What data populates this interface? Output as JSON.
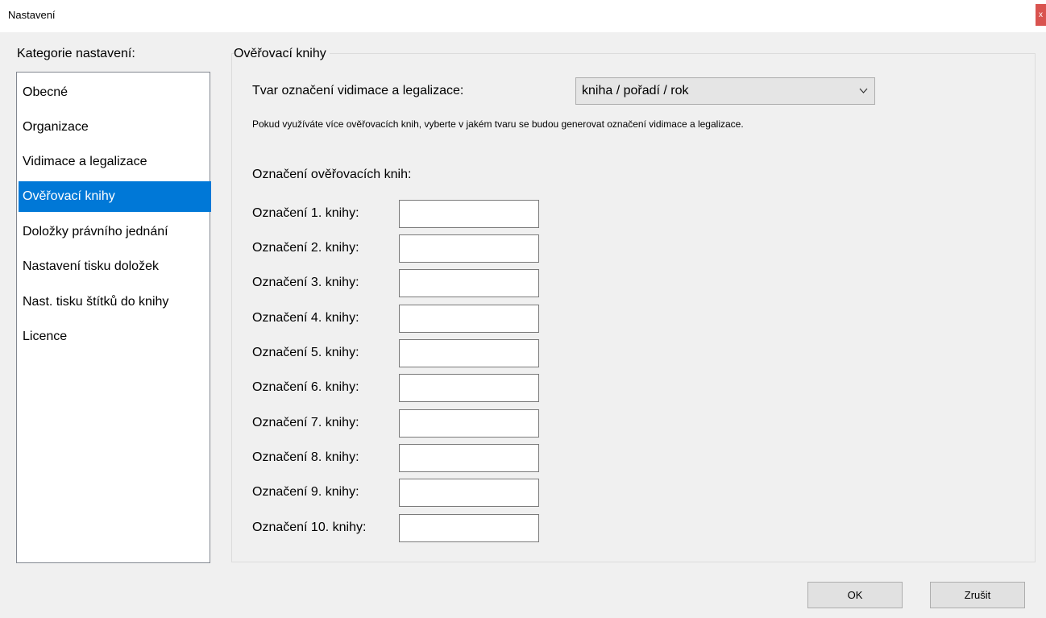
{
  "window": {
    "title": "Nastavení",
    "close_label": "x"
  },
  "categories": {
    "label": "Kategorie nastavení:",
    "items": [
      {
        "label": "Obecné",
        "selected": false
      },
      {
        "label": "Organizace",
        "selected": false
      },
      {
        "label": "Vidimace a legalizace",
        "selected": false
      },
      {
        "label": "Ověřovací knihy",
        "selected": true
      },
      {
        "label": "Doložky právního jednání",
        "selected": false
      },
      {
        "label": "Nastavení tisku doložek",
        "selected": false
      },
      {
        "label": "Nast. tisku štítků do knihy",
        "selected": false
      },
      {
        "label": "Licence",
        "selected": false
      }
    ]
  },
  "panel": {
    "legend": "Ověřovací knihy",
    "format_label": "Tvar označení vidimace a legalizace:",
    "format_value": "kniha / pořadí / rok",
    "hint": "Pokud využíváte více ověřovacích knih, vyberte v jakém tvaru se budou generovat označení vidimace a legalizace.",
    "books_heading": "Označení ověřovacích knih:",
    "books": [
      {
        "label": "Označení 1. knihy:",
        "value": ""
      },
      {
        "label": "Označení 2. knihy:",
        "value": ""
      },
      {
        "label": "Označení 3. knihy:",
        "value": ""
      },
      {
        "label": "Označení 4. knihy:",
        "value": ""
      },
      {
        "label": "Označení 5. knihy:",
        "value": ""
      },
      {
        "label": "Označení 6. knihy:",
        "value": ""
      },
      {
        "label": "Označení 7. knihy:",
        "value": ""
      },
      {
        "label": "Označení 8. knihy:",
        "value": ""
      },
      {
        "label": "Označení 9. knihy:",
        "value": ""
      },
      {
        "label": "Označení 10. knihy:",
        "value": ""
      }
    ]
  },
  "buttons": {
    "ok": "OK",
    "cancel": "Zrušit"
  }
}
